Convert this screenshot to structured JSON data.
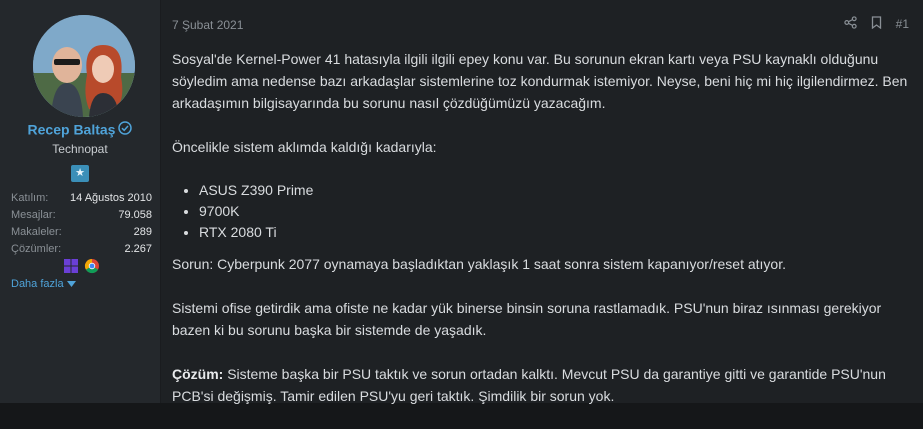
{
  "post": {
    "date": "7 Şubat 2021",
    "number": "#1"
  },
  "author": {
    "name": "Recep Baltaş",
    "title": "Technopat",
    "stats": [
      {
        "label": "Katılım:",
        "value": "14 Ağustos 2010"
      },
      {
        "label": "Mesajlar:",
        "value": "79.058"
      },
      {
        "label": "Makaleler:",
        "value": "289"
      },
      {
        "label": "Çözümler:",
        "value": "2.267"
      }
    ],
    "more_label": "Daha fazla"
  },
  "content": {
    "para1": "Sosyal'de Kernel-Power 41 hatasıyla ilgili ilgili epey konu var. Bu sorunun ekran kartı veya PSU kaynaklı olduğunu söyledim ama nedense bazı arkadaşlar sistemlerine toz kondurmak istemiyor. Neyse, beni hiç mi hiç ilgilendirmez. Ben arkadaşımın bilgisayarında bu sorunu nasıl çözdüğümüzü yazacağım.",
    "para2": "Öncelikle sistem aklımda kaldığı kadarıyla:",
    "specs": [
      "ASUS Z390 Prime",
      "9700K",
      "RTX 2080 Ti"
    ],
    "para3": "Sorun: Cyberpunk 2077 oynamaya başladıktan yaklaşık 1 saat sonra sistem kapanıyor/reset atıyor.",
    "para4": "Sistemi ofise getirdik ama ofiste ne kadar yük binerse binsin soruna rastlamadık. PSU'nun biraz ısınması gerekiyor bazen ki bu sorunu başka bir sistemde de yaşadık.",
    "solution_label": "Çözüm:",
    "solution_text": " Sisteme başka bir PSU taktık ve sorun ortadan kalktı. Mevcut PSU da garantiye gitti ve garantide PSU'nun PCB'si değişmiş. Tamir edilen PSU'yu geri taktık. Şimdilik bir sorun yok."
  },
  "colors": {
    "accent": "#4fa3d9",
    "sidebar_bg": "#24282c",
    "main_bg": "#1e2124",
    "text": "#d9dcdf",
    "muted": "#8a9096"
  },
  "icons": [
    "verified-icon",
    "badge-icon",
    "windows-icon",
    "chrome-icon",
    "chevron-down-icon",
    "share-icon",
    "bookmark-icon"
  ]
}
